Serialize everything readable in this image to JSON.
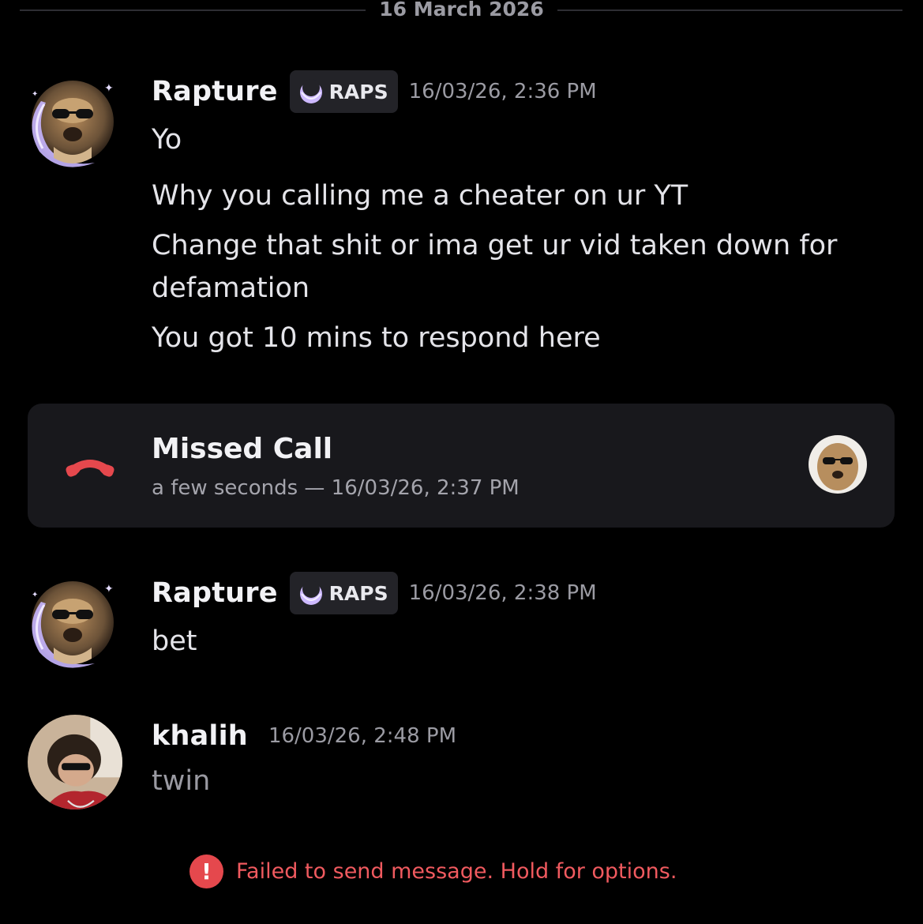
{
  "divider": {
    "date": "16 March 2026"
  },
  "messages": [
    {
      "username": "Rapture",
      "tag": "RAPS",
      "timestamp": "16/03/26, 2:36 PM",
      "lines": [
        "Yo",
        "Why you calling me a cheater on ur YT",
        "Change that shit or ima get ur vid taken down for",
        "defamation",
        "You got 10 mins to respond here"
      ]
    },
    {
      "username": "Rapture",
      "tag": "RAPS",
      "timestamp": "16/03/26, 2:38 PM",
      "lines": [
        "bet"
      ]
    },
    {
      "username": "khalih",
      "timestamp": "16/03/26, 2:48 PM",
      "lines": [
        "twin"
      ]
    }
  ],
  "missed_call": {
    "title": "Missed Call",
    "subtitle": "a few seconds — 16/03/26, 2:37 PM"
  },
  "error": {
    "icon": "!",
    "text": "Failed to send message. Hold for options."
  },
  "colors": {
    "background": "#000000",
    "card": "#18181c",
    "error": "#e5484d",
    "call_icon": "#e5484d",
    "avatar_ring": "#b9a4f5"
  },
  "icons": [
    "crescent-ring-avatar",
    "crescent-badge-icon",
    "phone-hangup-icon",
    "error-icon"
  ]
}
